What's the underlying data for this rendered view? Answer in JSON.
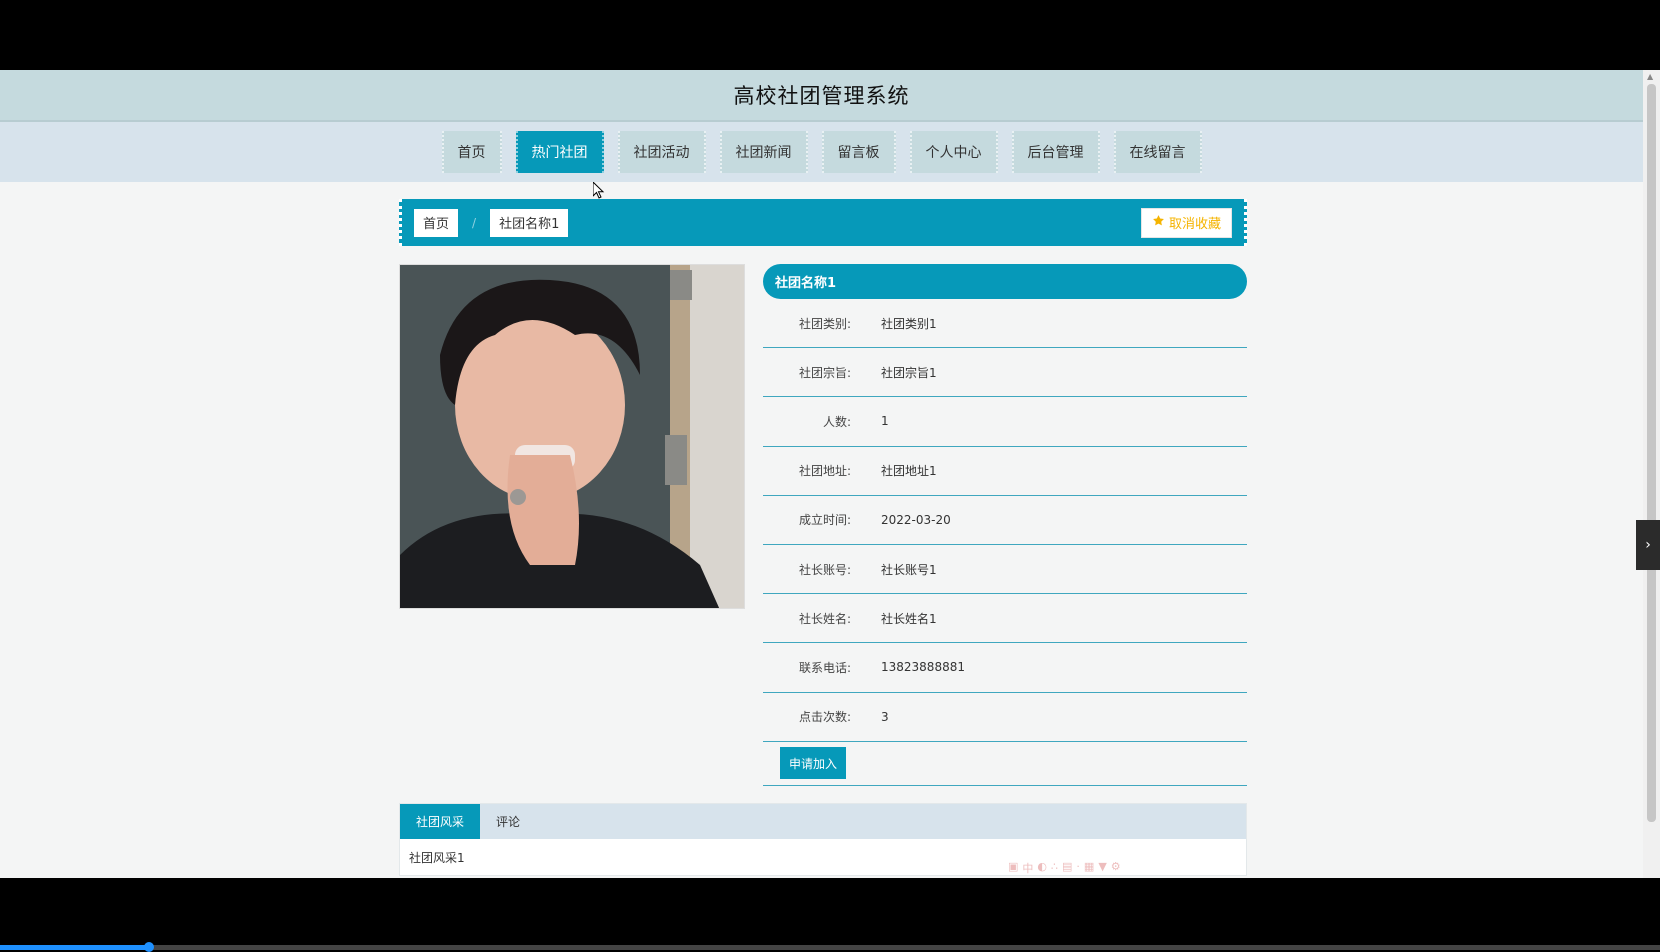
{
  "app": {
    "title": "高校社团管理系统"
  },
  "nav": {
    "items": [
      {
        "label": "首页"
      },
      {
        "label": "热门社团"
      },
      {
        "label": "社团活动"
      },
      {
        "label": "社团新闻"
      },
      {
        "label": "留言板"
      },
      {
        "label": "个人中心"
      },
      {
        "label": "后台管理"
      },
      {
        "label": "在线留言"
      }
    ],
    "active": "热门社团"
  },
  "breadcrumb": {
    "home": "首页",
    "separator": "/",
    "current": "社团名称1",
    "favorite_label": "取消收藏",
    "favorite_icon": "star-icon"
  },
  "detail": {
    "name": "社团名称1",
    "fields": [
      {
        "label": "社团类别:",
        "value": "社团类别1"
      },
      {
        "label": "社团宗旨:",
        "value": "社团宗旨1"
      },
      {
        "label": "人数:",
        "value": "1"
      },
      {
        "label": "社团地址:",
        "value": "社团地址1"
      },
      {
        "label": "成立时间:",
        "value": "2022-03-20"
      },
      {
        "label": "社长账号:",
        "value": "社长账号1"
      },
      {
        "label": "社长姓名:",
        "value": "社长姓名1"
      },
      {
        "label": "联系电话:",
        "value": "13823888881"
      },
      {
        "label": "点击次数:",
        "value": "3"
      }
    ],
    "apply_label": "申请加入"
  },
  "tabs": {
    "items": [
      {
        "label": "社团风采"
      },
      {
        "label": "评论"
      }
    ],
    "active": "社团风采",
    "content": "社团风采1"
  },
  "video": {
    "progress": 0.09
  },
  "colors": {
    "accent": "#0699b9",
    "header": "#c5dade",
    "nav_bg": "#d7e3ec",
    "favorite": "#f5b400"
  }
}
